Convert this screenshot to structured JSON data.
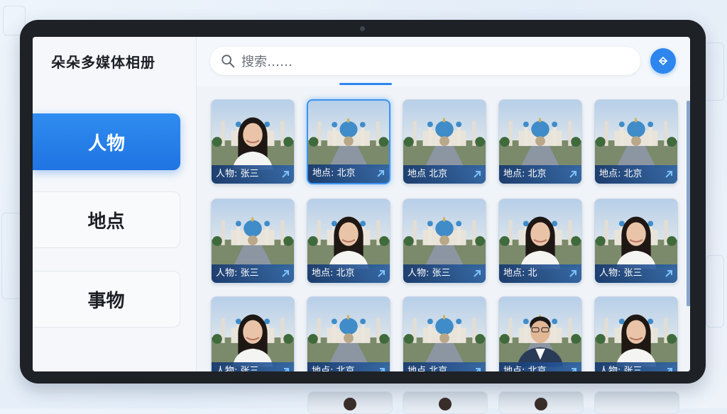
{
  "sidebar": {
    "title": "朵朵多媒体相册",
    "items": [
      {
        "label": "人物",
        "active": true
      },
      {
        "label": "地点",
        "active": false
      },
      {
        "label": "事物",
        "active": false
      }
    ]
  },
  "search": {
    "placeholder": "搜索……"
  },
  "action_button": {
    "icon": "share-icon"
  },
  "colors": {
    "accent": "#2d86ee",
    "caption_bg": "#1c4a8c",
    "sidebar_bg": "#f5f7fa"
  },
  "grid": {
    "tiles": [
      {
        "caption": "人物: 张三",
        "kind": "person-woman",
        "selected": false
      },
      {
        "caption": "地点: 北京",
        "kind": "place",
        "selected": true
      },
      {
        "caption": "地点 北京",
        "kind": "place",
        "selected": false
      },
      {
        "caption": "地点: 北京",
        "kind": "place",
        "selected": false
      },
      {
        "caption": "地点: 北京",
        "kind": "place",
        "selected": false
      },
      {
        "caption": "人物: 张三",
        "kind": "place",
        "selected": false
      },
      {
        "caption": "地点: 北京",
        "kind": "person-woman",
        "selected": false
      },
      {
        "caption": "人物: 张三",
        "kind": "place",
        "selected": false
      },
      {
        "caption": "地点: 北",
        "kind": "person-woman",
        "selected": false
      },
      {
        "caption": "人物: 张三",
        "kind": "person-woman",
        "selected": false
      },
      {
        "caption": "人物: 张三",
        "kind": "person-woman",
        "selected": false
      },
      {
        "caption": "地点: 北京",
        "kind": "place",
        "selected": false
      },
      {
        "caption": "地点 北京",
        "kind": "place",
        "selected": false
      },
      {
        "caption": "地点: 北京",
        "kind": "person-man",
        "selected": false
      },
      {
        "caption": "人物: 张三",
        "kind": "person-woman",
        "selected": false
      }
    ]
  }
}
